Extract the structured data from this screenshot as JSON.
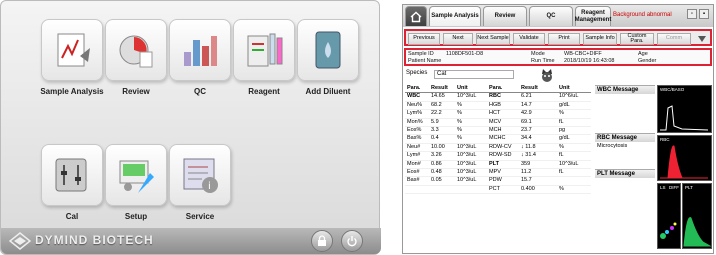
{
  "home_menu": {
    "tiles": [
      {
        "label": "Sample Analysis",
        "icon": "sample-analysis-icon"
      },
      {
        "label": "Review",
        "icon": "review-icon"
      },
      {
        "label": "QC",
        "icon": "qc-icon"
      },
      {
        "label": "Reagent",
        "icon": "reagent-icon"
      },
      {
        "label": "Add Diluent",
        "icon": "add-diluent-icon"
      },
      {
        "label": "Cal",
        "icon": "cal-icon"
      },
      {
        "label": "Setup",
        "icon": "setup-icon"
      },
      {
        "label": "Service",
        "icon": "service-icon"
      }
    ],
    "brand": "DYMIND BIOTECH"
  },
  "analysis": {
    "tabs": {
      "sample_analysis": "Sample Analysis",
      "review": "Review",
      "qc": "QC",
      "reagent": "Reagent Management"
    },
    "alarm": "Background abnormal",
    "toolbar": {
      "previous": "Previous",
      "next": "Next",
      "next_sample": "Next Sample",
      "validate": "Validate",
      "print": "Print",
      "sample_info": "Sample Info",
      "custom_para": "Custom Para.",
      "comm": "Comm"
    },
    "info": {
      "sample_id_label": "Sample ID",
      "sample_id": "1108DF501-D8",
      "mode_label": "Mode",
      "mode": "WB-CBC+DIFF",
      "age_label": "Age",
      "patient_name_label": "Patient Name",
      "run_time_label": "Run Time",
      "run_time": "2018/10/19 16:43:08",
      "gender_label": "Gender"
    },
    "species_label": "Species",
    "species": "Cat",
    "table_headers": {
      "para": "Para.",
      "result": "Result",
      "unit": "Unit"
    },
    "left_rows": [
      [
        "WBC",
        "14.65",
        "10^3/uL"
      ],
      [
        "Neu%",
        "68.2",
        "%"
      ],
      [
        "Lym%",
        "22.2",
        "%"
      ],
      [
        "Mon%",
        "5.9",
        "%"
      ],
      [
        "Eos%",
        "3.3",
        "%"
      ],
      [
        "Bas%",
        "0.4",
        "%"
      ],
      [
        "Neu#",
        "10.00",
        "10^3/uL"
      ],
      [
        "Lym#",
        "3.26",
        "10^3/uL"
      ],
      [
        "Mon#",
        "0.86",
        "10^3/uL"
      ],
      [
        "Eos#",
        "0.48",
        "10^3/uL"
      ],
      [
        "Bas#",
        "0.05",
        "10^3/uL"
      ]
    ],
    "right_rows": [
      [
        "RBC",
        "6.21",
        "10^6/uL"
      ],
      [
        "HGB",
        "14.7",
        "g/dL"
      ],
      [
        "HCT",
        "42.9",
        "%"
      ],
      [
        "MCV",
        "69.1",
        "fL"
      ],
      [
        "MCH",
        "23.7",
        "pg"
      ],
      [
        "MCHC",
        "34.4",
        "g/dL"
      ],
      [
        "RDW-CV",
        "↓ 11.8",
        "%"
      ],
      [
        "RDW-SD",
        "↓ 31.4",
        "fL"
      ],
      [
        "PLT",
        "359",
        "10^3/uL"
      ],
      [
        "MPV",
        "11.2",
        "fL"
      ],
      [
        "PDW",
        "15.7",
        ""
      ],
      [
        "PCT",
        "0.400",
        "%"
      ]
    ],
    "messages": {
      "wbc": "WBC Message",
      "rbc": "RBC Message",
      "rbc_text": "Microcytosis",
      "plt": "PLT Message"
    },
    "plots": {
      "wbcbaso": "WBC/BASO",
      "rbc": "RBC",
      "plt": "PLT",
      "ls": "LS",
      "diff": "DIFF"
    }
  },
  "colors": {
    "highlight": "#dd2233",
    "alarm": "#cc0000"
  }
}
